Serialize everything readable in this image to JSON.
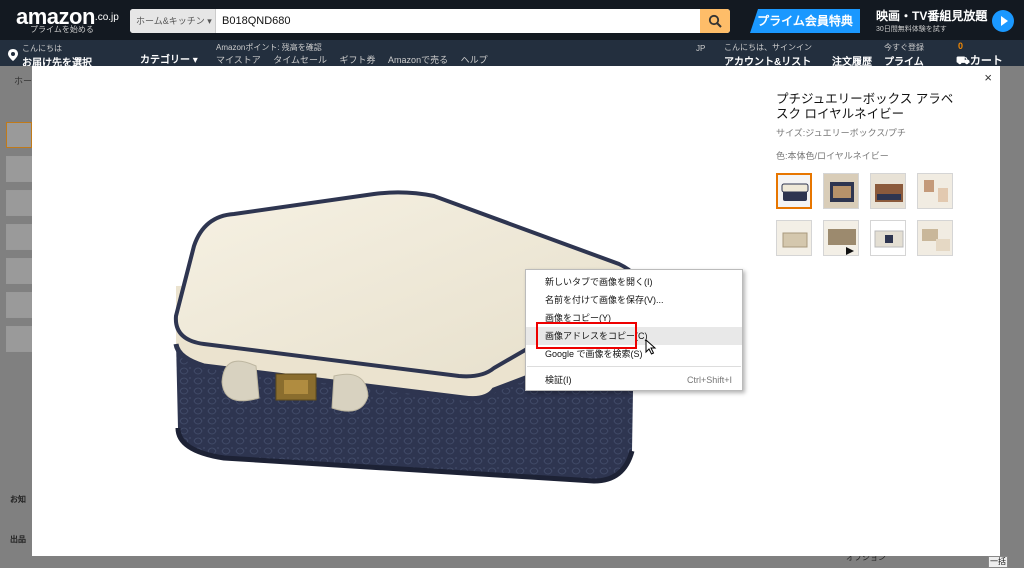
{
  "header": {
    "logo_main": "amazon",
    "logo_suffix": ".co.jp",
    "logo_tag": "プライムを始める",
    "search_category": "ホーム&キッチン",
    "search_query": "B018QND680",
    "prime_banner": "プライム会員特典",
    "tv_banner_title": "映画・TV番組見放題",
    "tv_banner_sub": "30日間無料体験を試す",
    "deliver_greeting": "こんにちは",
    "deliver_label": "お届け先を選択",
    "category_menu": "カテゴリー",
    "points_text": "Amazonポイント: 残高を確認",
    "nav_links": "マイストア タイムセール ギフト券 Amazonで売る ヘルプ",
    "lang": "JP",
    "account_greeting": "こんにちは、サインイン",
    "account_label": "アカウント&リスト",
    "orders_label": "注文履歴",
    "prime_nav_top": "今すぐ登録",
    "prime_nav_label": "プライム",
    "cart_label": "カート",
    "cart_count": "0"
  },
  "page": {
    "breadcrumb": "ホー",
    "bottom_label_1": "お知",
    "bottom_label_2": "出品",
    "bottom_right": "オプション",
    "bulk_button": "一括"
  },
  "modal": {
    "close": "×",
    "product_title": "プチジュエリーボックス アラベスク ロイヤルネイビー",
    "size": "サイズ:ジュエリーボックス/プチ",
    "color": "色:本体色/ロイヤルネイビー"
  },
  "context_menu": {
    "items": [
      {
        "label": "新しいタブで画像を開く(I)",
        "shortcut": ""
      },
      {
        "label": "名前を付けて画像を保存(V)...",
        "shortcut": ""
      },
      {
        "label": "画像をコピー(Y)",
        "shortcut": ""
      },
      {
        "label": "画像アドレスをコピー(C)",
        "shortcut": ""
      },
      {
        "label": "Google で画像を検索(S)",
        "shortcut": ""
      },
      {
        "label": "検証(I)",
        "shortcut": "Ctrl+Shift+I"
      }
    ],
    "highlighted_index": 3
  },
  "colors": {
    "header_dark": "#131921",
    "header_sub": "#232f3e",
    "search_button": "#febd69",
    "prime_blue": "#1a98ff",
    "thumb_selected": "#e77600",
    "highlight_box": "#e00000",
    "box_navy": "#2e3550",
    "box_cream": "#efe9d8"
  },
  "icons": {
    "search": "magnifier-icon",
    "location": "location-pin-icon",
    "cart": "cart-icon",
    "close": "close-icon",
    "cursor": "mouse-pointer-icon",
    "play": "play-icon"
  }
}
